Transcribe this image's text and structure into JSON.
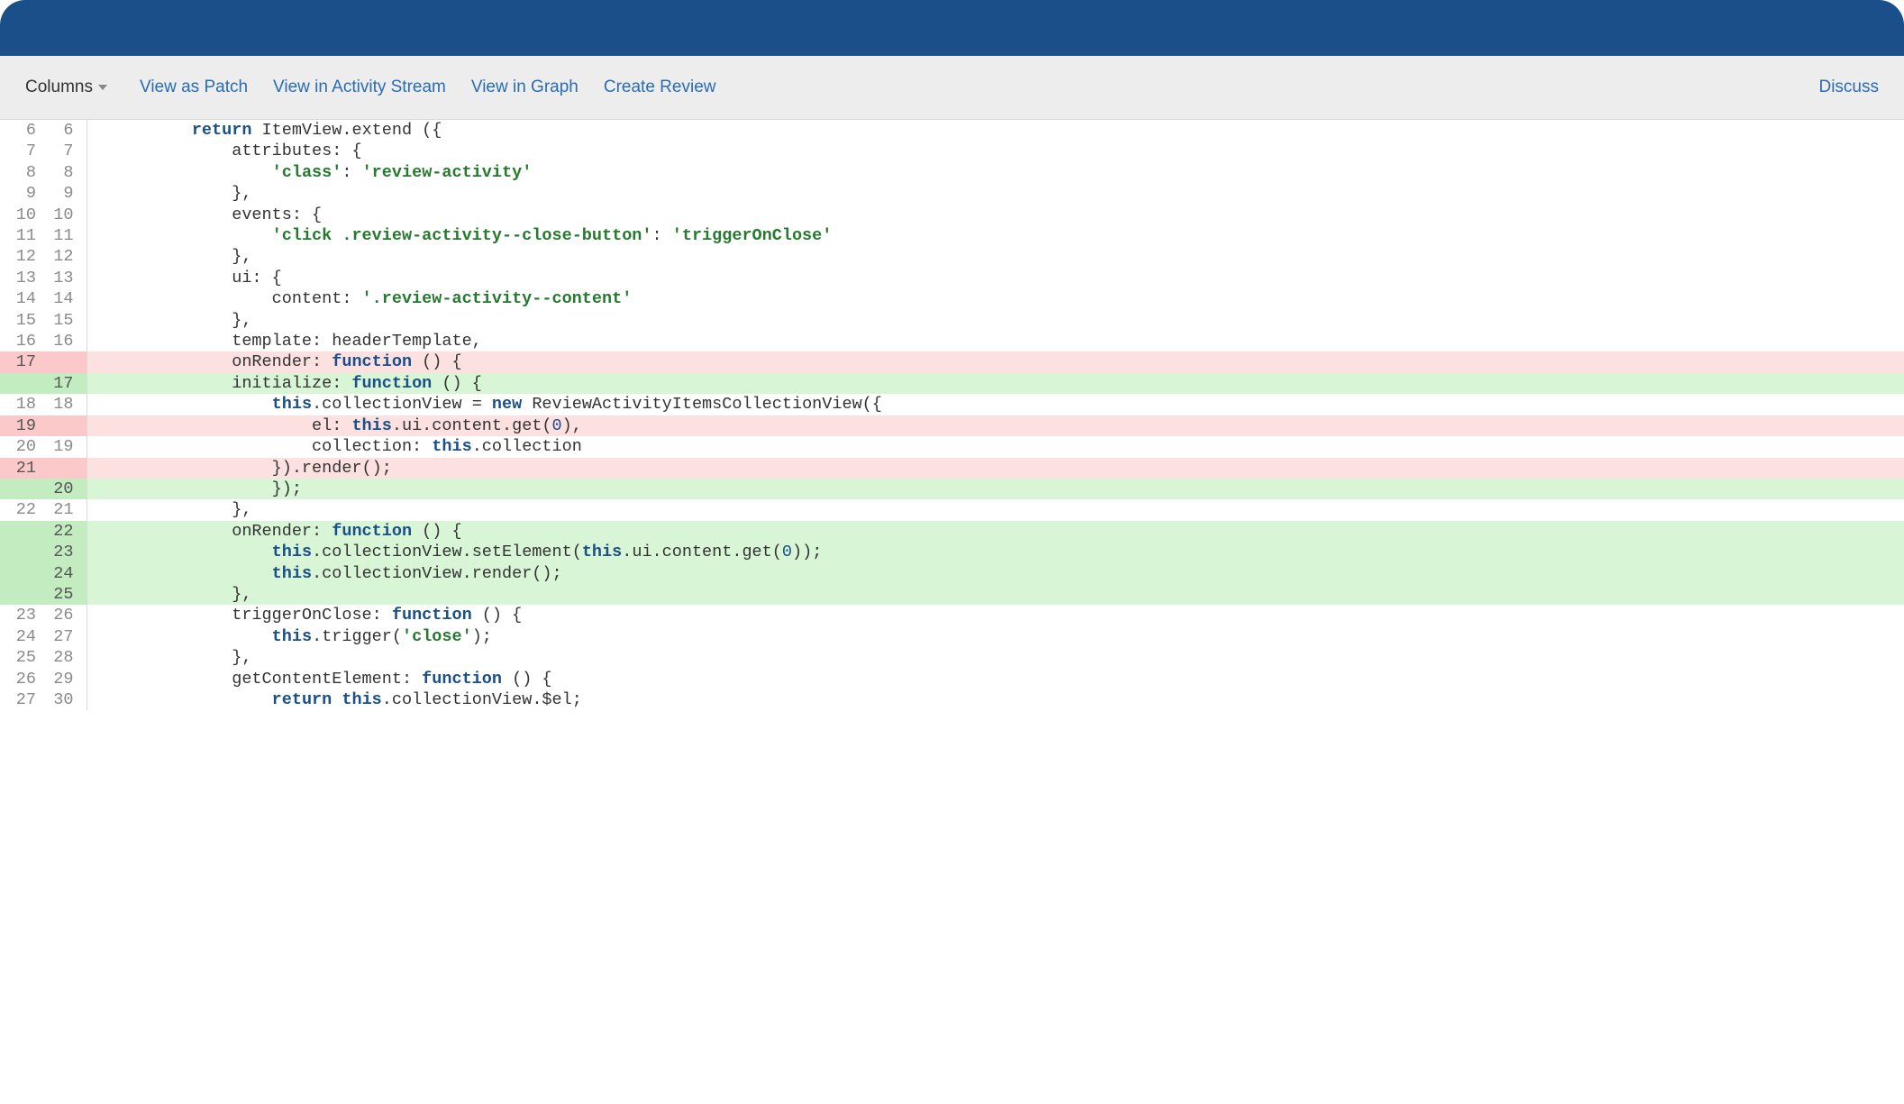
{
  "toolbar": {
    "columns_label": "Columns",
    "links": {
      "view_patch": "View as Patch",
      "view_activity": "View in Activity Stream",
      "view_graph": "View in Graph",
      "create_review": "Create Review"
    },
    "discuss": "Discuss"
  },
  "diff": {
    "lines": [
      {
        "type": "ctx",
        "old": "6",
        "new": "6",
        "text": "        return ItemView.extend ({",
        "tokens": [
          [
            "        ",
            ""
          ],
          [
            "return",
            "kw"
          ],
          [
            " ItemView.extend ({",
            ""
          ]
        ]
      },
      {
        "type": "ctx",
        "old": "7",
        "new": "7",
        "text": "            attributes: {",
        "tokens": [
          [
            "            attributes: {",
            ""
          ]
        ]
      },
      {
        "type": "ctx",
        "old": "8",
        "new": "8",
        "text": "                'class': 'review-activity'",
        "tokens": [
          [
            "                ",
            ""
          ],
          [
            "'class'",
            "str"
          ],
          [
            ": ",
            ""
          ],
          [
            "'review-activity'",
            "str"
          ]
        ]
      },
      {
        "type": "ctx",
        "old": "9",
        "new": "9",
        "text": "            },",
        "tokens": [
          [
            "            },",
            ""
          ]
        ]
      },
      {
        "type": "ctx",
        "old": "10",
        "new": "10",
        "text": "            events: {",
        "tokens": [
          [
            "            events: {",
            ""
          ]
        ]
      },
      {
        "type": "ctx",
        "old": "11",
        "new": "11",
        "text": "                'click .review-activity--close-button': 'triggerOnClose'",
        "tokens": [
          [
            "                ",
            ""
          ],
          [
            "'click .review-activity--close-button'",
            "str"
          ],
          [
            ": ",
            ""
          ],
          [
            "'triggerOnClose'",
            "str"
          ]
        ]
      },
      {
        "type": "ctx",
        "old": "12",
        "new": "12",
        "text": "            },",
        "tokens": [
          [
            "            },",
            ""
          ]
        ]
      },
      {
        "type": "ctx",
        "old": "13",
        "new": "13",
        "text": "            ui: {",
        "tokens": [
          [
            "            ui: {",
            ""
          ]
        ]
      },
      {
        "type": "ctx",
        "old": "14",
        "new": "14",
        "text": "                content: '.review-activity--content'",
        "tokens": [
          [
            "                content: ",
            ""
          ],
          [
            "'.review-activity--content'",
            "str"
          ]
        ]
      },
      {
        "type": "ctx",
        "old": "15",
        "new": "15",
        "text": "            },",
        "tokens": [
          [
            "            },",
            ""
          ]
        ]
      },
      {
        "type": "ctx",
        "old": "16",
        "new": "16",
        "text": "            template: headerTemplate,",
        "tokens": [
          [
            "            template: headerTemplate,",
            ""
          ]
        ]
      },
      {
        "type": "del",
        "old": "17",
        "new": "",
        "text": "            onRender: function () {",
        "tokens": [
          [
            "            onRender: ",
            ""
          ],
          [
            "function",
            "kw"
          ],
          [
            " () {",
            ""
          ]
        ]
      },
      {
        "type": "add",
        "old": "",
        "new": "17",
        "text": "            initialize: function () {",
        "tokens": [
          [
            "            initialize: ",
            ""
          ],
          [
            "function",
            "kw"
          ],
          [
            " () {",
            ""
          ]
        ]
      },
      {
        "type": "ctx",
        "old": "18",
        "new": "18",
        "text": "                this.collectionView = new ReviewActivityItemsCollectionView({",
        "tokens": [
          [
            "                ",
            ""
          ],
          [
            "this",
            "kw"
          ],
          [
            ".collectionView = ",
            ""
          ],
          [
            "new",
            "kw"
          ],
          [
            " ReviewActivityItemsCollectionView({",
            ""
          ]
        ]
      },
      {
        "type": "del",
        "old": "19",
        "new": "",
        "text": "                    el: this.ui.content.get(0),",
        "tokens": [
          [
            "                    el: ",
            ""
          ],
          [
            "this",
            "kw"
          ],
          [
            ".ui.content.get(",
            ""
          ],
          [
            "0",
            "num"
          ],
          [
            "),",
            ""
          ]
        ]
      },
      {
        "type": "ctx",
        "old": "20",
        "new": "19",
        "text": "                    collection: this.collection",
        "tokens": [
          [
            "                    collection: ",
            ""
          ],
          [
            "this",
            "kw"
          ],
          [
            ".collection",
            ""
          ]
        ]
      },
      {
        "type": "del",
        "old": "21",
        "new": "",
        "text": "                }).render();",
        "tokens": [
          [
            "                }).render();",
            ""
          ]
        ]
      },
      {
        "type": "add",
        "old": "",
        "new": "20",
        "text": "                });",
        "tokens": [
          [
            "                });",
            ""
          ]
        ]
      },
      {
        "type": "ctx",
        "old": "22",
        "new": "21",
        "text": "            },",
        "tokens": [
          [
            "            },",
            ""
          ]
        ]
      },
      {
        "type": "add",
        "old": "",
        "new": "22",
        "text": "            onRender: function () {",
        "tokens": [
          [
            "            onRender: ",
            ""
          ],
          [
            "function",
            "kw"
          ],
          [
            " () {",
            ""
          ]
        ]
      },
      {
        "type": "add",
        "old": "",
        "new": "23",
        "text": "                this.collectionView.setElement(this.ui.content.get(0));",
        "tokens": [
          [
            "                ",
            ""
          ],
          [
            "this",
            "kw"
          ],
          [
            ".collectionView.setElement(",
            ""
          ],
          [
            "this",
            "kw"
          ],
          [
            ".ui.content.get(",
            ""
          ],
          [
            "0",
            "num"
          ],
          [
            "));",
            ""
          ]
        ]
      },
      {
        "type": "add",
        "old": "",
        "new": "24",
        "text": "                this.collectionView.render();",
        "tokens": [
          [
            "                ",
            ""
          ],
          [
            "this",
            "kw"
          ],
          [
            ".collectionView.render();",
            ""
          ]
        ]
      },
      {
        "type": "add",
        "old": "",
        "new": "25",
        "text": "            },",
        "tokens": [
          [
            "            },",
            ""
          ]
        ]
      },
      {
        "type": "ctx",
        "old": "23",
        "new": "26",
        "text": "            triggerOnClose: function () {",
        "tokens": [
          [
            "            triggerOnClose: ",
            ""
          ],
          [
            "function",
            "kw"
          ],
          [
            " () {",
            ""
          ]
        ]
      },
      {
        "type": "ctx",
        "old": "24",
        "new": "27",
        "text": "                this.trigger('close');",
        "tokens": [
          [
            "                ",
            ""
          ],
          [
            "this",
            "kw"
          ],
          [
            ".trigger(",
            ""
          ],
          [
            "'close'",
            "str"
          ],
          [
            ");",
            ""
          ]
        ]
      },
      {
        "type": "ctx",
        "old": "25",
        "new": "28",
        "text": "            },",
        "tokens": [
          [
            "            },",
            ""
          ]
        ]
      },
      {
        "type": "ctx",
        "old": "26",
        "new": "29",
        "text": "            getContentElement: function () {",
        "tokens": [
          [
            "            getContentElement: ",
            ""
          ],
          [
            "function",
            "kw"
          ],
          [
            " () {",
            ""
          ]
        ]
      },
      {
        "type": "ctx",
        "old": "27",
        "new": "30",
        "text": "                return this.collectionView.$el;",
        "tokens": [
          [
            "                ",
            ""
          ],
          [
            "return",
            "kw"
          ],
          [
            " ",
            ""
          ],
          [
            "this",
            "kw"
          ],
          [
            ".collectionView.$el;",
            ""
          ]
        ]
      }
    ]
  }
}
